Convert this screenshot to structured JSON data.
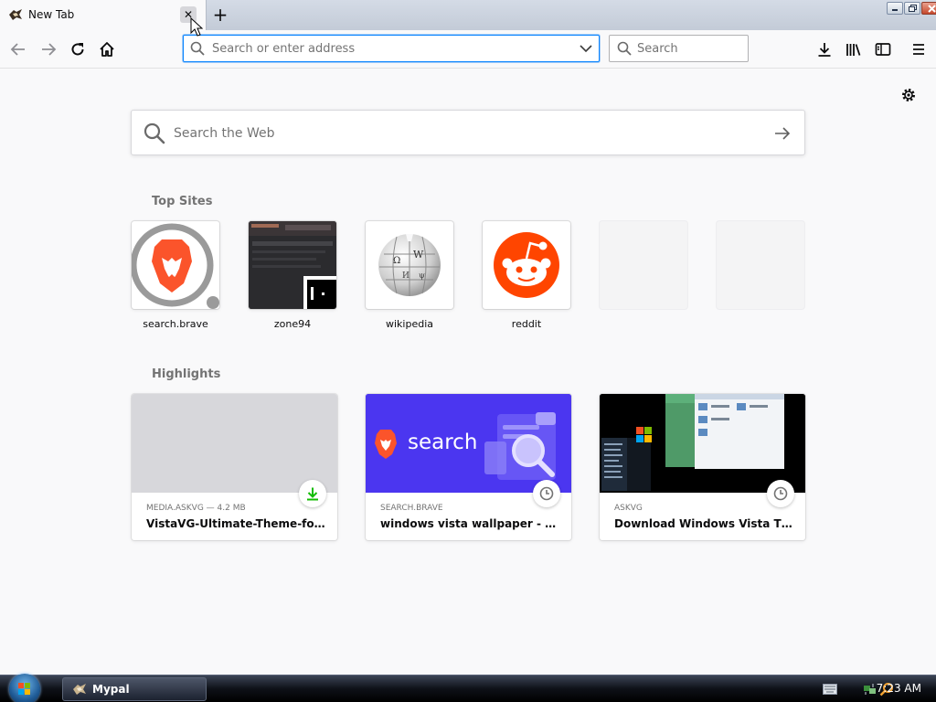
{
  "browser": {
    "tab": {
      "title": "New Tab",
      "close_symbol": "✕"
    },
    "new_tab_symbol": "+"
  },
  "toolbar": {
    "address_placeholder": "Search or enter address",
    "search_placeholder": "Search"
  },
  "newtab": {
    "web_search_placeholder": "Search the Web",
    "top_sites_title": "Top Sites",
    "top_sites": [
      {
        "label": "search.brave",
        "icon": "brave-lion-icon",
        "color": "#fb542b"
      },
      {
        "label": "zone94",
        "icon": "zone94-screenshot"
      },
      {
        "label": "wikipedia",
        "icon": "wikipedia-globe-icon"
      },
      {
        "label": "reddit",
        "icon": "reddit-alien-icon",
        "color": "#ff4500"
      },
      {
        "label": ""
      },
      {
        "label": ""
      }
    ],
    "highlights_title": "Highlights",
    "highlights": [
      {
        "source": "MEDIA.ASKVG — 4.2 MB",
        "title": "VistaVG-Ultimate-Theme-for-W...",
        "badge": "download-icon"
      },
      {
        "source": "SEARCH.BRAVE",
        "title": "windows vista wallpaper - Brave...",
        "badge": "clock-icon",
        "image_text": "search"
      },
      {
        "source": "ASKVG",
        "title": "Download Windows Vista Them...",
        "badge": "clock-icon"
      }
    ]
  },
  "taskbar": {
    "app_label": "Mypal",
    "clock": "7:23 AM"
  },
  "colors": {
    "accent": "#0a84ff",
    "brave": "#fb542b",
    "reddit": "#ff4500",
    "brave_search_bg": "#4b36f0",
    "download_green": "#12bc00"
  }
}
